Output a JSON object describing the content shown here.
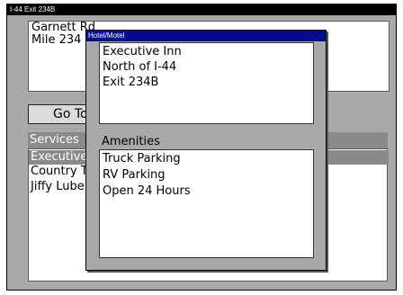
{
  "window": {
    "title": "I-44 Exit 234B"
  },
  "location": {
    "lines": [
      "Garnett Rd",
      "Mile 234"
    ]
  },
  "goto": {
    "label": "Go To"
  },
  "services": {
    "header": "Services",
    "items": [
      "Executive",
      "Country T",
      "Jiffy Lube"
    ]
  },
  "popup": {
    "title": "Hotel/Motel",
    "info_lines": [
      "Executive Inn",
      "North of I-44",
      "Exit 234B"
    ],
    "amenities_label": "Amenities",
    "amenities": [
      "Truck Parking",
      "RV Parking",
      "Open 24 Hours"
    ]
  },
  "colors": {
    "title_bar": "#000000",
    "popup_title_bar": "#050d8c",
    "window_bg": "#a9a9a9",
    "selection": "#8a8a8a"
  }
}
